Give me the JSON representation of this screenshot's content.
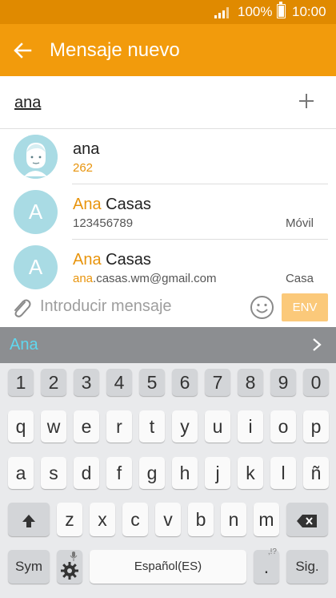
{
  "status_bar": {
    "battery": "100%",
    "time": "10:00"
  },
  "app_bar": {
    "title": "Mensaje nuevo"
  },
  "recipient": {
    "value": "ana"
  },
  "suggestions": [
    {
      "name_hl": "",
      "name_rest": "ana",
      "sub_hl": "",
      "sub_rest": "262",
      "type": ""
    },
    {
      "name_hl": "Ana",
      "name_rest": " Casas",
      "sub_hl": "",
      "sub_rest": "123456789",
      "type": "Móvil",
      "avatar_letter": "A"
    },
    {
      "name_hl": "Ana",
      "name_rest": " Casas",
      "sub_hl": "ana",
      "sub_rest": ".casas.wm@gmail.com",
      "type": "Casa",
      "avatar_letter": "A"
    }
  ],
  "compose": {
    "placeholder": "Introducir mensaje",
    "send_label": "ENV"
  },
  "keyboard": {
    "prediction": "Ana",
    "numbers": [
      "1",
      "2",
      "3",
      "4",
      "5",
      "6",
      "7",
      "8",
      "9",
      "0"
    ],
    "row1": [
      "q",
      "w",
      "e",
      "r",
      "t",
      "y",
      "u",
      "i",
      "o",
      "p"
    ],
    "row2": [
      "a",
      "s",
      "d",
      "f",
      "g",
      "h",
      "j",
      "k",
      "l",
      "ñ"
    ],
    "row3": [
      "z",
      "x",
      "c",
      "v",
      "b",
      "n",
      "m"
    ],
    "sym_label": "Sym",
    "space_label": "Español(ES)",
    "period_label": ".",
    "period_hint": ",!?",
    "go_label": "Sig."
  },
  "colors": {
    "status_bar": "#e08a00",
    "app_bar": "#f29b0c",
    "highlight": "#e8940c",
    "prediction": "#5fd8ef"
  }
}
